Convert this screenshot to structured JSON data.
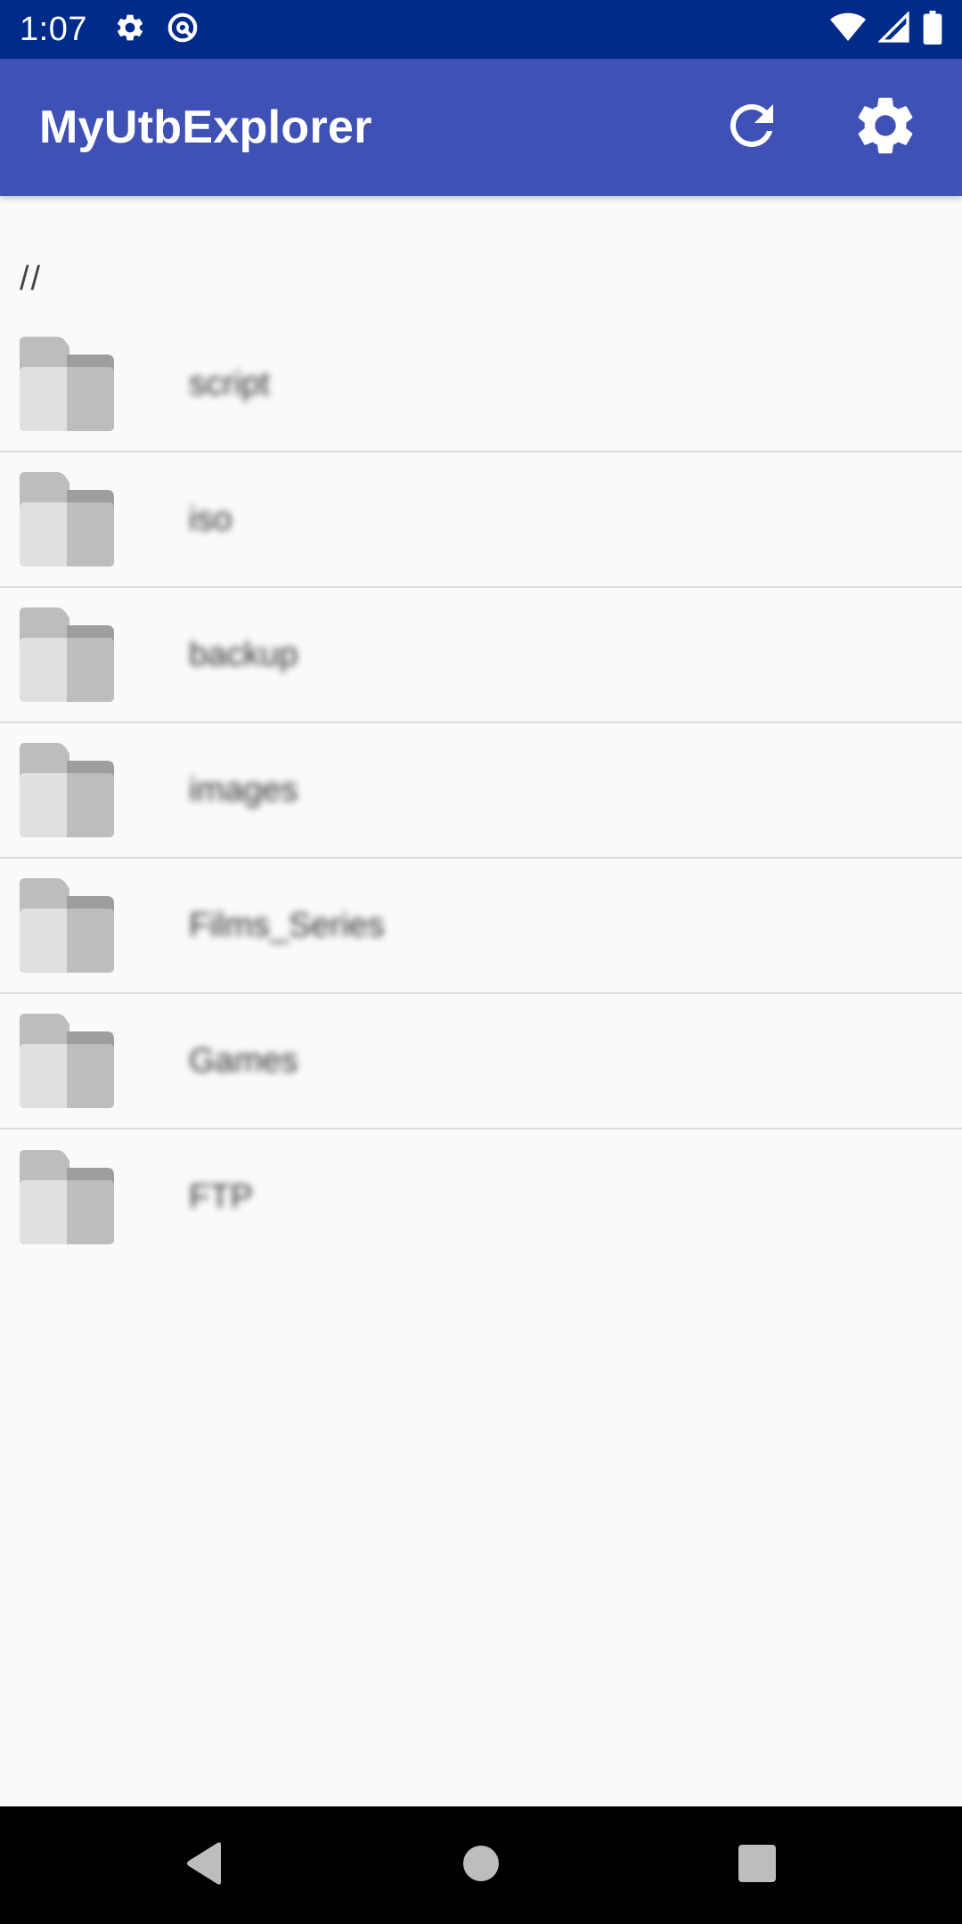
{
  "status_bar": {
    "time": "1:07",
    "left_icons": [
      "gear-icon",
      "data-saver-icon"
    ],
    "right_icons": [
      "wifi-icon",
      "signal-icon",
      "battery-icon"
    ],
    "background_color": "#002b8a"
  },
  "app_bar": {
    "title": "MyUtbExplorer",
    "background_color": "#3f51b5",
    "actions": [
      "refresh-icon",
      "settings-icon"
    ]
  },
  "path": "//",
  "files": [
    {
      "name": "script",
      "type": "folder"
    },
    {
      "name": "iso",
      "type": "folder"
    },
    {
      "name": "backup",
      "type": "folder"
    },
    {
      "name": "images",
      "type": "folder"
    },
    {
      "name": "Films_Series",
      "type": "folder"
    },
    {
      "name": "Games",
      "type": "folder"
    },
    {
      "name": "FTP",
      "type": "folder"
    }
  ],
  "nav_bar": {
    "buttons": [
      "back-icon",
      "home-icon",
      "recents-icon"
    ]
  }
}
